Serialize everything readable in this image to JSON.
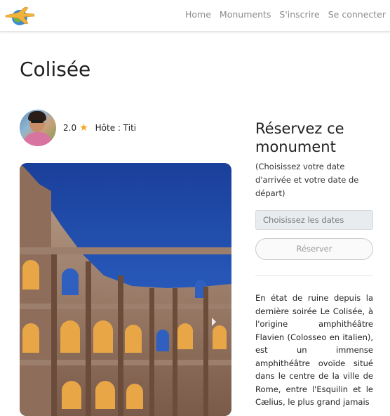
{
  "nav": {
    "logo_icon": "plane-globe-logo",
    "links": [
      "Home",
      "Monuments",
      "S'inscrire",
      "Se connecter"
    ]
  },
  "page": {
    "title": "Colisée"
  },
  "host": {
    "rating": "2.0",
    "star_icon": "star-icon",
    "label": "Hôte : Titi"
  },
  "booking": {
    "title": "Réservez ce monument",
    "subtitle": "(Choisissez votre date d'arrivée et votre date de départ)",
    "date_placeholder": "Choisissez les dates",
    "reserve_label": "Réserver"
  },
  "description": "En état de ruine depuis la dernière soirée Le Colisée, à l'origine amphithéâtre Flavien (Colosseo en italien), est un immense amphithéâtre ovoïde situé dans le centre de la ville de Rome, entre l'Esquilin et le Cælius, le plus grand jamais",
  "colors": {
    "star": "#f5a623",
    "sky": "#1f4aa8",
    "stone": "#b58e6a"
  }
}
